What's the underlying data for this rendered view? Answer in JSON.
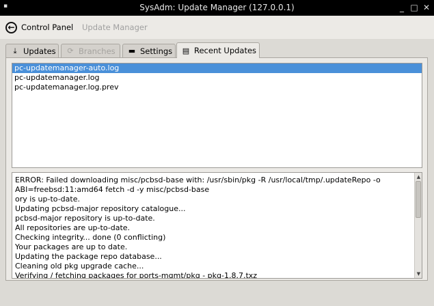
{
  "window": {
    "title": "SysAdm: Update Manager (127.0.0.1)",
    "menu_glyph": "▪",
    "min_glyph": "_",
    "max_glyph": "□",
    "close_glyph": "✕"
  },
  "toolbar": {
    "back_label": "Control Panel",
    "current_label": "Update Manager"
  },
  "tabs": [
    {
      "label": "Updates",
      "icon": "download-icon",
      "glyph": "⤓"
    },
    {
      "label": "Branches",
      "icon": "refresh-icon",
      "glyph": "⟳"
    },
    {
      "label": "Settings",
      "icon": "drive-icon",
      "glyph": "▬"
    },
    {
      "label": "Recent Updates",
      "icon": "archive-icon",
      "glyph": "▤"
    }
  ],
  "active_tab": "Recent Updates",
  "log_files": [
    "pc-updatemanager-auto.log",
    "pc-updatemanager.log",
    "pc-updatemanager.log.prev"
  ],
  "selected_log": "pc-updatemanager-auto.log",
  "log_lines": [
    "ERROR: Failed downloading misc/pcbsd-base with: /usr/sbin/pkg -R /usr/local/tmp/.updateRepo  -o",
    "ABI=freebsd:11:amd64 fetch -d -y misc/pcbsd-base",
    "ory is up-to-date.",
    "Updating pcbsd-major repository catalogue...",
    "pcbsd-major repository is up-to-date.",
    "All repositories are up-to-date.",
    "Checking integrity... done (0 conflicting)",
    "Your packages are up to date.",
    "Updating the package repo database...",
    "Cleaning old pkg upgrade cache...",
    "Verifying / fetching packages for ports-mgmt/pkg - pkg-1.8.7.txz"
  ],
  "scrollbar": {
    "up_glyph": "▲",
    "down_glyph": "▼"
  }
}
